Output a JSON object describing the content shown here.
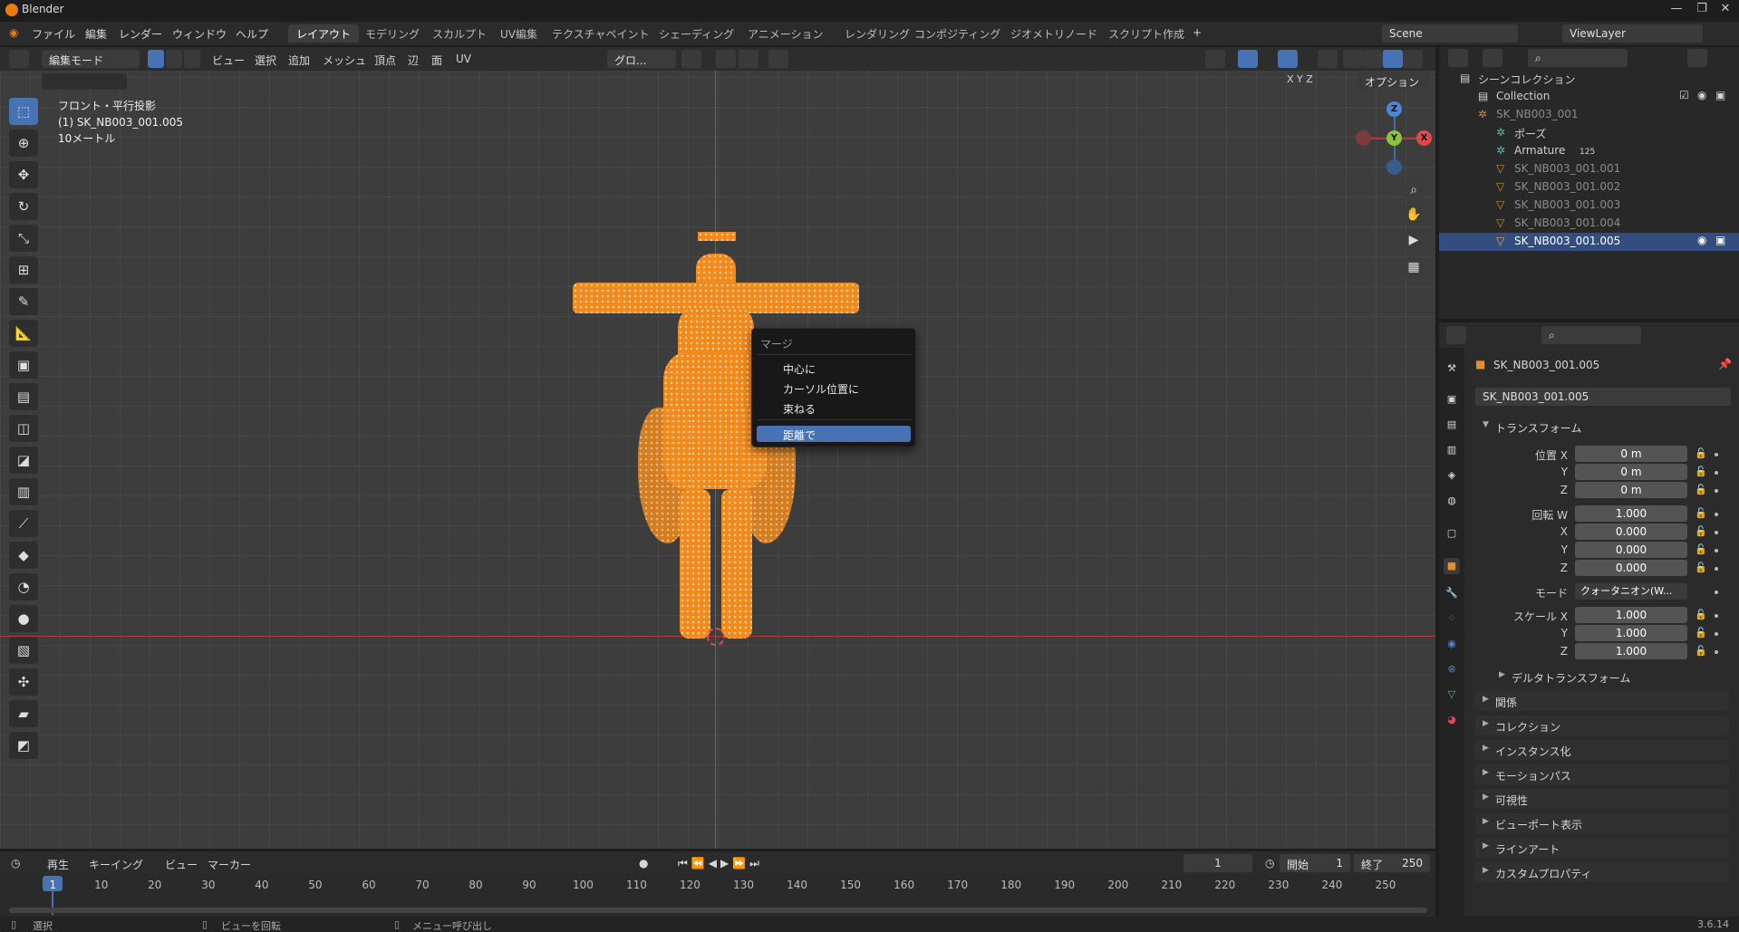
{
  "app": {
    "title": "Blender",
    "version": "3.6.14"
  },
  "menu": {
    "file": "ファイル",
    "edit": "編集",
    "render": "レンダー",
    "window": "ウィンドウ",
    "help": "ヘルプ"
  },
  "workspaces": [
    "レイアウト",
    "モデリング",
    "スカルプト",
    "UV編集",
    "テクスチャペイント",
    "シェーディング",
    "アニメーション",
    "レンダリング",
    "コンポジティング",
    "ジオメトリノード",
    "スクリプト作成"
  ],
  "scene": {
    "name": "Scene",
    "view_layer": "ViewLayer"
  },
  "viewport_header": {
    "mode": "編集モード",
    "view": "ビュー",
    "select": "選択",
    "add": "追加",
    "mesh": "メッシュ",
    "vertex": "頂点",
    "edge": "辺",
    "face": "面",
    "uv": "UV",
    "transform": "グロ...",
    "options": "オプション",
    "x": "X",
    "y": "Y",
    "z": "Z"
  },
  "viewport_info": {
    "line1": "フロント・平行投影",
    "line2": "(1) SK_NB003_001.005",
    "line3": "10メートル"
  },
  "gizmo": {
    "z": "Z",
    "y": "Y",
    "x": "X"
  },
  "merge_menu": {
    "title": "マージ",
    "items": [
      "中心に",
      "カーソル位置に",
      "束ねる",
      "距離で"
    ],
    "highlighted": "距離で"
  },
  "timeline": {
    "play": "再生",
    "keying": "キーイング",
    "view": "ビュー",
    "marker": "マーカー",
    "current_frame": "1",
    "start_label": "開始",
    "start": "1",
    "end_label": "終了",
    "end": "250",
    "ticks": [
      "1",
      "10",
      "20",
      "30",
      "40",
      "50",
      "60",
      "70",
      "80",
      "90",
      "100",
      "110",
      "120",
      "130",
      "140",
      "150",
      "160",
      "170",
      "180",
      "190",
      "200",
      "210",
      "220",
      "230",
      "240",
      "250"
    ]
  },
  "statusbar": {
    "select": "選択",
    "rotate": "ビューを回転",
    "menu": "メニュー呼び出し"
  },
  "outliner": {
    "scene_collection": "シーンコレクション",
    "collection": "Collection",
    "items": [
      {
        "name": "SK_NB003_001",
        "dim": true
      },
      {
        "name": "ポーズ",
        "dim": false
      },
      {
        "name": "Armature",
        "badge": "125",
        "dim": false
      },
      {
        "name": "SK_NB003_001.001",
        "dim": true
      },
      {
        "name": "SK_NB003_001.002",
        "dim": true
      },
      {
        "name": "SK_NB003_001.003",
        "dim": true
      },
      {
        "name": "SK_NB003_001.004",
        "dim": true
      },
      {
        "name": "SK_NB003_001.005",
        "selected": true
      }
    ]
  },
  "properties": {
    "object_name": "SK_NB003_001.005",
    "data_name": "SK_NB003_001.005",
    "transform_header": "トランスフォーム",
    "location_label": "位置 X",
    "loc_x": "0 m",
    "loc_y": "0 m",
    "loc_z": "0 m",
    "rotation_label": "回転 W",
    "rot_w": "1.000",
    "rot_x": "0.000",
    "rot_y": "0.000",
    "rot_z": "0.000",
    "mode_label": "モード",
    "mode_value": "クォータニオン(W...",
    "scale_label": "スケール X",
    "scale_x": "1.000",
    "scale_y": "1.000",
    "scale_z": "1.000",
    "y_label": "Y",
    "z_label": "Z",
    "x_label": "X",
    "delta": "デルタトランスフォーム",
    "sections": [
      "関係",
      "コレクション",
      "インスタンス化",
      "モーションパス",
      "可視性",
      "ビューポート表示",
      "ラインアート",
      "カスタムプロパティ"
    ]
  },
  "colors": {
    "accent": "#4772b3",
    "mesh": "#f08a1c",
    "axis_x": "#b13a3a",
    "axis_z": "#3b6fae"
  }
}
